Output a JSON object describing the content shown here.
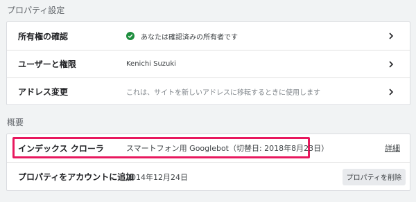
{
  "property_settings": {
    "section_title": "プロパティ設定",
    "rows": [
      {
        "label": "所有権の確認",
        "value": "あなたは確認済みの所有者です",
        "status_color": "#1e8e3e"
      },
      {
        "label": "ユーザーと権限",
        "value": "Kenichi Suzuki"
      },
      {
        "label": "アドレス変更",
        "value": "これは、サイトを新しいアドレスに移転するときに使用します"
      }
    ]
  },
  "overview": {
    "section_title": "概要",
    "index_crawler": {
      "label": "インデックス クローラ",
      "value": "スマートフォン用 Googlebot（切替日: 2018年8月23日）",
      "link": "詳細",
      "highlight_color": "#e8185e"
    },
    "account_added": {
      "label": "プロパティをアカウントに追加",
      "value": "2014年12月24日",
      "button": "プロパティを削除"
    }
  }
}
